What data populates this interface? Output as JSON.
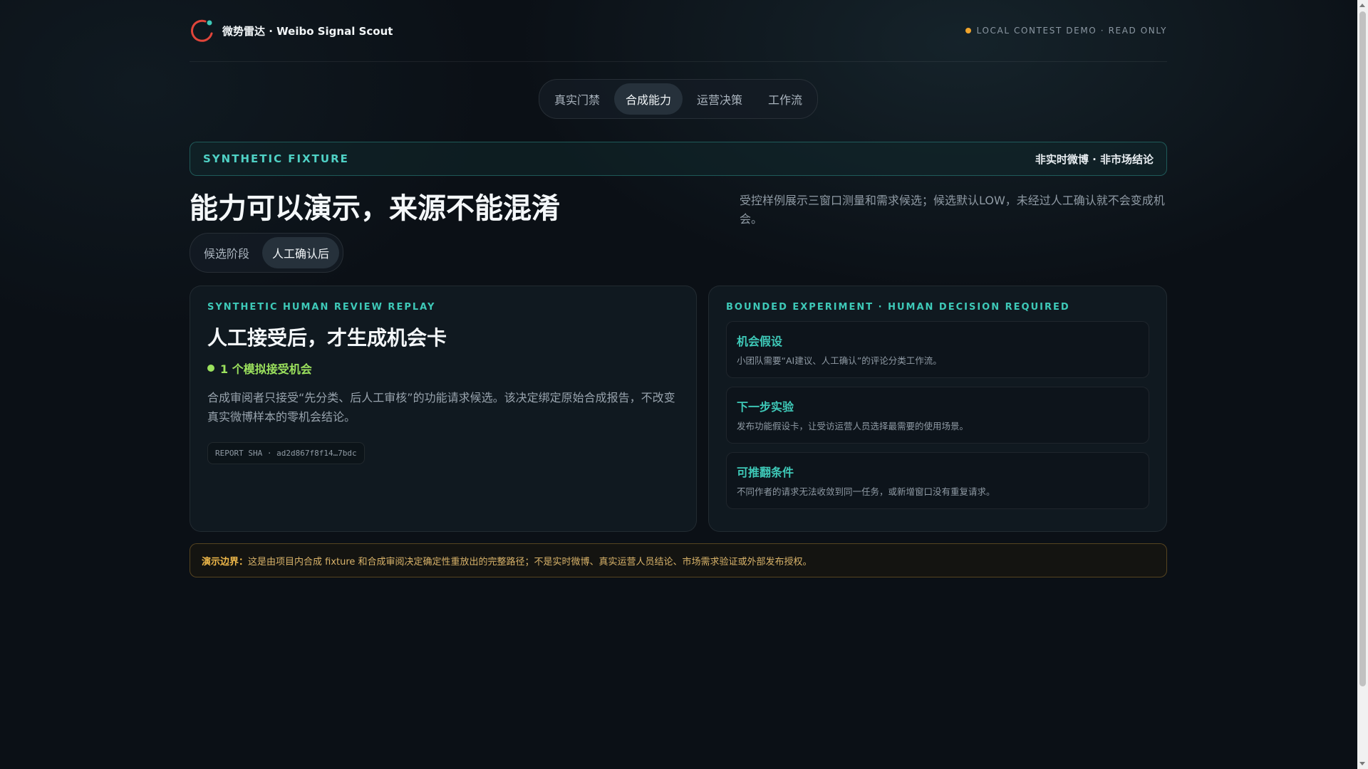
{
  "header": {
    "brand_title": "微势雷达 · Weibo Signal Scout",
    "status_text": "LOCAL CONTEST DEMO · READ ONLY"
  },
  "tabs": [
    {
      "label": "真实门禁",
      "active": false
    },
    {
      "label": "合成能力",
      "active": true
    },
    {
      "label": "运营决策",
      "active": false
    },
    {
      "label": "工作流",
      "active": false
    }
  ],
  "banner": {
    "label": "SYNTHETIC FIXTURE",
    "right_text": "非实时微博 · 非市场结论"
  },
  "hero": {
    "title": "能力可以演示，来源不能混淆",
    "description": "受控样例展示三窗口测量和需求候选；候选默认LOW，未经过人工确认就不会变成机会。"
  },
  "segment": [
    {
      "label": "候选阶段",
      "active": false
    },
    {
      "label": "人工确认后",
      "active": true
    }
  ],
  "review_card": {
    "kicker": "SYNTHETIC HUMAN REVIEW REPLAY",
    "title": "人工接受后，才生成机会卡",
    "accept_text": "1 个模拟接受机会",
    "description": "合成审阅者只接受“先分类、后人工审核”的功能请求候选。该决定绑定原始合成报告，不改变真实微博样本的零机会结论。",
    "sha": "REPORT SHA · ad2d867f8f14…7bdc"
  },
  "experiment_card": {
    "kicker": "BOUNDED EXPERIMENT · HUMAN DECISION REQUIRED",
    "items": [
      {
        "title": "机会假设",
        "desc": "小团队需要“AI建议、人工确认”的评论分类工作流。"
      },
      {
        "title": "下一步实验",
        "desc": "发布功能假设卡，让受访运营人员选择最需要的使用场景。"
      },
      {
        "title": "可推翻条件",
        "desc": "不同作者的请求无法收敛到同一任务，或新增窗口没有重复请求。"
      }
    ]
  },
  "note": {
    "label": "演示边界：",
    "text": "这是由项目内合成 fixture 和合成审阅决定确定性重放出的完整路径；不是实时微博、真实运营人员结论、市场需求验证或外部发布授权。"
  },
  "colors": {
    "accent_teal": "#3ec9b8",
    "accent_green": "#9be15d",
    "accent_amber": "#f0a42c",
    "logo_red": "#e0453a"
  }
}
